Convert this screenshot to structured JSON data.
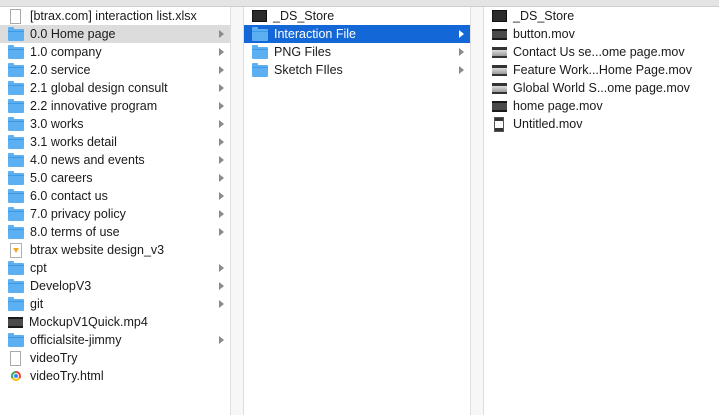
{
  "columns": [
    {
      "items": [
        {
          "label": "[btrax.com] interaction list.xlsx",
          "icon": "document-icon",
          "arrow": false,
          "state": ""
        },
        {
          "label": "0.0 Home page",
          "icon": "folder-icon",
          "arrow": true,
          "state": "selected-inactive"
        },
        {
          "label": "1.0 company",
          "icon": "folder-icon",
          "arrow": true,
          "state": ""
        },
        {
          "label": "2.0 service",
          "icon": "folder-icon",
          "arrow": true,
          "state": ""
        },
        {
          "label": "2.1 global design consult",
          "icon": "folder-icon",
          "arrow": true,
          "state": ""
        },
        {
          "label": "2.2 innovative program",
          "icon": "folder-icon",
          "arrow": true,
          "state": ""
        },
        {
          "label": "3.0 works",
          "icon": "folder-icon",
          "arrow": true,
          "state": ""
        },
        {
          "label": "3.1 works detail",
          "icon": "folder-icon",
          "arrow": true,
          "state": ""
        },
        {
          "label": "4.0 news and events",
          "icon": "folder-icon",
          "arrow": true,
          "state": ""
        },
        {
          "label": "5.0 careers",
          "icon": "folder-icon",
          "arrow": true,
          "state": ""
        },
        {
          "label": "6.0 contact us",
          "icon": "folder-icon",
          "arrow": true,
          "state": ""
        },
        {
          "label": "7.0 privacy policy",
          "icon": "folder-icon",
          "arrow": true,
          "state": ""
        },
        {
          "label": "8.0 terms of use",
          "icon": "folder-icon",
          "arrow": true,
          "state": ""
        },
        {
          "label": "btrax website design_v3",
          "icon": "sketch-file-icon",
          "arrow": false,
          "state": ""
        },
        {
          "label": "cpt",
          "icon": "folder-icon",
          "arrow": true,
          "state": ""
        },
        {
          "label": "DevelopV3",
          "icon": "folder-icon",
          "arrow": true,
          "state": ""
        },
        {
          "label": "git",
          "icon": "folder-icon",
          "arrow": true,
          "state": ""
        },
        {
          "label": "MockupV1Quick.mp4",
          "icon": "video-icon",
          "arrow": false,
          "state": ""
        },
        {
          "label": "officialsite-jimmy",
          "icon": "folder-icon",
          "arrow": true,
          "state": ""
        },
        {
          "label": "videoTry",
          "icon": "document-icon",
          "arrow": false,
          "state": ""
        },
        {
          "label": "videoTry.html",
          "icon": "chrome-html-icon",
          "arrow": false,
          "state": ""
        }
      ]
    },
    {
      "items": [
        {
          "label": "_DS_Store",
          "icon": "black-file-icon",
          "arrow": false,
          "state": ""
        },
        {
          "label": "Interaction File",
          "icon": "folder-icon",
          "arrow": true,
          "state": "selected"
        },
        {
          "label": "PNG Files",
          "icon": "folder-icon",
          "arrow": true,
          "state": ""
        },
        {
          "label": "Sketch FIles",
          "icon": "folder-icon",
          "arrow": true,
          "state": ""
        }
      ]
    },
    {
      "items": [
        {
          "label": "_DS_Store",
          "icon": "black-file-icon",
          "arrow": false,
          "state": ""
        },
        {
          "label": "button.mov",
          "icon": "movie-icon",
          "arrow": false,
          "state": ""
        },
        {
          "label": "Contact Us se...ome page.mov",
          "icon": "movie-light-icon",
          "arrow": false,
          "state": ""
        },
        {
          "label": "Feature Work...Home Page.mov",
          "icon": "movie-light-icon",
          "arrow": false,
          "state": ""
        },
        {
          "label": "Global World S...ome page.mov",
          "icon": "movie-light-icon",
          "arrow": false,
          "state": ""
        },
        {
          "label": "home page.mov",
          "icon": "movie-icon",
          "arrow": false,
          "state": ""
        },
        {
          "label": "Untitled.mov",
          "icon": "film-icon",
          "arrow": false,
          "state": ""
        }
      ]
    }
  ],
  "colors": {
    "selection_active": "#1467d6",
    "selection_inactive": "#dcdcdc",
    "folder": "#5cb0f2"
  }
}
